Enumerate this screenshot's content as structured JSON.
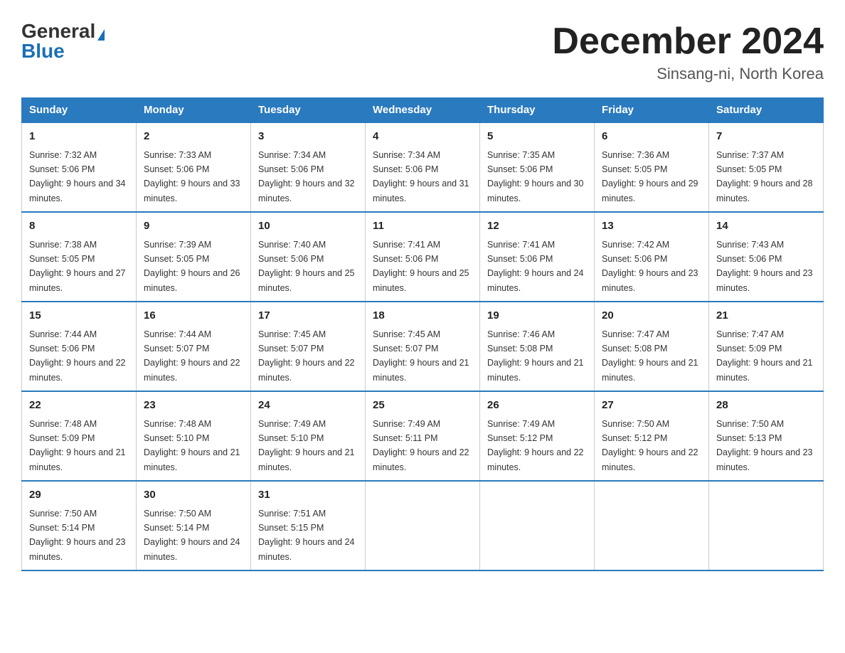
{
  "header": {
    "logo_general": "General",
    "logo_blue": "Blue",
    "month_title": "December 2024",
    "location": "Sinsang-ni, North Korea"
  },
  "days_of_week": [
    "Sunday",
    "Monday",
    "Tuesday",
    "Wednesday",
    "Thursday",
    "Friday",
    "Saturday"
  ],
  "weeks": [
    [
      {
        "day": "1",
        "sunrise": "7:32 AM",
        "sunset": "5:06 PM",
        "daylight": "9 hours and 34 minutes."
      },
      {
        "day": "2",
        "sunrise": "7:33 AM",
        "sunset": "5:06 PM",
        "daylight": "9 hours and 33 minutes."
      },
      {
        "day": "3",
        "sunrise": "7:34 AM",
        "sunset": "5:06 PM",
        "daylight": "9 hours and 32 minutes."
      },
      {
        "day": "4",
        "sunrise": "7:34 AM",
        "sunset": "5:06 PM",
        "daylight": "9 hours and 31 minutes."
      },
      {
        "day": "5",
        "sunrise": "7:35 AM",
        "sunset": "5:06 PM",
        "daylight": "9 hours and 30 minutes."
      },
      {
        "day": "6",
        "sunrise": "7:36 AM",
        "sunset": "5:05 PM",
        "daylight": "9 hours and 29 minutes."
      },
      {
        "day": "7",
        "sunrise": "7:37 AM",
        "sunset": "5:05 PM",
        "daylight": "9 hours and 28 minutes."
      }
    ],
    [
      {
        "day": "8",
        "sunrise": "7:38 AM",
        "sunset": "5:05 PM",
        "daylight": "9 hours and 27 minutes."
      },
      {
        "day": "9",
        "sunrise": "7:39 AM",
        "sunset": "5:05 PM",
        "daylight": "9 hours and 26 minutes."
      },
      {
        "day": "10",
        "sunrise": "7:40 AM",
        "sunset": "5:06 PM",
        "daylight": "9 hours and 25 minutes."
      },
      {
        "day": "11",
        "sunrise": "7:41 AM",
        "sunset": "5:06 PM",
        "daylight": "9 hours and 25 minutes."
      },
      {
        "day": "12",
        "sunrise": "7:41 AM",
        "sunset": "5:06 PM",
        "daylight": "9 hours and 24 minutes."
      },
      {
        "day": "13",
        "sunrise": "7:42 AM",
        "sunset": "5:06 PM",
        "daylight": "9 hours and 23 minutes."
      },
      {
        "day": "14",
        "sunrise": "7:43 AM",
        "sunset": "5:06 PM",
        "daylight": "9 hours and 23 minutes."
      }
    ],
    [
      {
        "day": "15",
        "sunrise": "7:44 AM",
        "sunset": "5:06 PM",
        "daylight": "9 hours and 22 minutes."
      },
      {
        "day": "16",
        "sunrise": "7:44 AM",
        "sunset": "5:07 PM",
        "daylight": "9 hours and 22 minutes."
      },
      {
        "day": "17",
        "sunrise": "7:45 AM",
        "sunset": "5:07 PM",
        "daylight": "9 hours and 22 minutes."
      },
      {
        "day": "18",
        "sunrise": "7:45 AM",
        "sunset": "5:07 PM",
        "daylight": "9 hours and 21 minutes."
      },
      {
        "day": "19",
        "sunrise": "7:46 AM",
        "sunset": "5:08 PM",
        "daylight": "9 hours and 21 minutes."
      },
      {
        "day": "20",
        "sunrise": "7:47 AM",
        "sunset": "5:08 PM",
        "daylight": "9 hours and 21 minutes."
      },
      {
        "day": "21",
        "sunrise": "7:47 AM",
        "sunset": "5:09 PM",
        "daylight": "9 hours and 21 minutes."
      }
    ],
    [
      {
        "day": "22",
        "sunrise": "7:48 AM",
        "sunset": "5:09 PM",
        "daylight": "9 hours and 21 minutes."
      },
      {
        "day": "23",
        "sunrise": "7:48 AM",
        "sunset": "5:10 PM",
        "daylight": "9 hours and 21 minutes."
      },
      {
        "day": "24",
        "sunrise": "7:49 AM",
        "sunset": "5:10 PM",
        "daylight": "9 hours and 21 minutes."
      },
      {
        "day": "25",
        "sunrise": "7:49 AM",
        "sunset": "5:11 PM",
        "daylight": "9 hours and 22 minutes."
      },
      {
        "day": "26",
        "sunrise": "7:49 AM",
        "sunset": "5:12 PM",
        "daylight": "9 hours and 22 minutes."
      },
      {
        "day": "27",
        "sunrise": "7:50 AM",
        "sunset": "5:12 PM",
        "daylight": "9 hours and 22 minutes."
      },
      {
        "day": "28",
        "sunrise": "7:50 AM",
        "sunset": "5:13 PM",
        "daylight": "9 hours and 23 minutes."
      }
    ],
    [
      {
        "day": "29",
        "sunrise": "7:50 AM",
        "sunset": "5:14 PM",
        "daylight": "9 hours and 23 minutes."
      },
      {
        "day": "30",
        "sunrise": "7:50 AM",
        "sunset": "5:14 PM",
        "daylight": "9 hours and 24 minutes."
      },
      {
        "day": "31",
        "sunrise": "7:51 AM",
        "sunset": "5:15 PM",
        "daylight": "9 hours and 24 minutes."
      },
      null,
      null,
      null,
      null
    ]
  ]
}
